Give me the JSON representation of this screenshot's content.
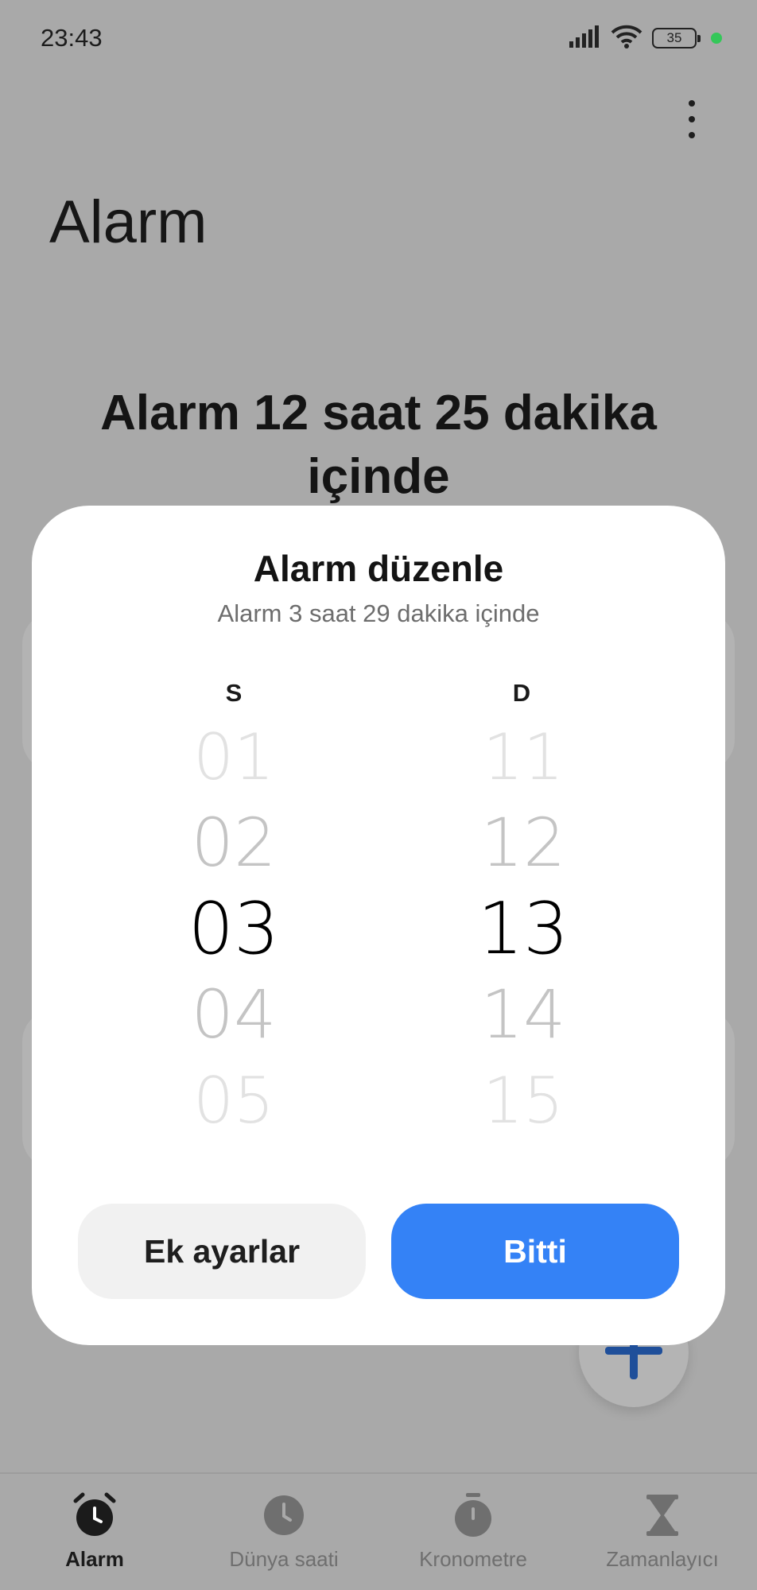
{
  "status_bar": {
    "time": "23:43",
    "battery_level": "35"
  },
  "header": {
    "title": "Alarm"
  },
  "next_alarm_text": "Alarm 12 saat 25 dakika içinde",
  "dialog": {
    "title": "Alarm düzenle",
    "subtitle": "Alarm 3 saat 29 dakika içinde",
    "hour_column_label": "S",
    "minute_column_label": "D",
    "hours": [
      "01",
      "02",
      "03",
      "04",
      "05"
    ],
    "minutes": [
      "11",
      "12",
      "13",
      "14",
      "15"
    ],
    "selected_hour": "03",
    "selected_minute": "13",
    "extra_settings_label": "Ek ayarlar",
    "done_label": "Bitti"
  },
  "bottom_nav": {
    "items": [
      {
        "label": "Alarm",
        "icon": "alarm-clock-icon",
        "active": true
      },
      {
        "label": "Dünya saati",
        "icon": "clock-icon",
        "active": false
      },
      {
        "label": "Kronometre",
        "icon": "stopwatch-icon",
        "active": false
      },
      {
        "label": "Zamanlayıcı",
        "icon": "hourglass-icon",
        "active": false
      }
    ]
  },
  "colors": {
    "accent": "#3482f6",
    "scrim_background": "#a9a9a9",
    "fab_plus": "#1f4f9a",
    "status_dot": "#34c759"
  }
}
